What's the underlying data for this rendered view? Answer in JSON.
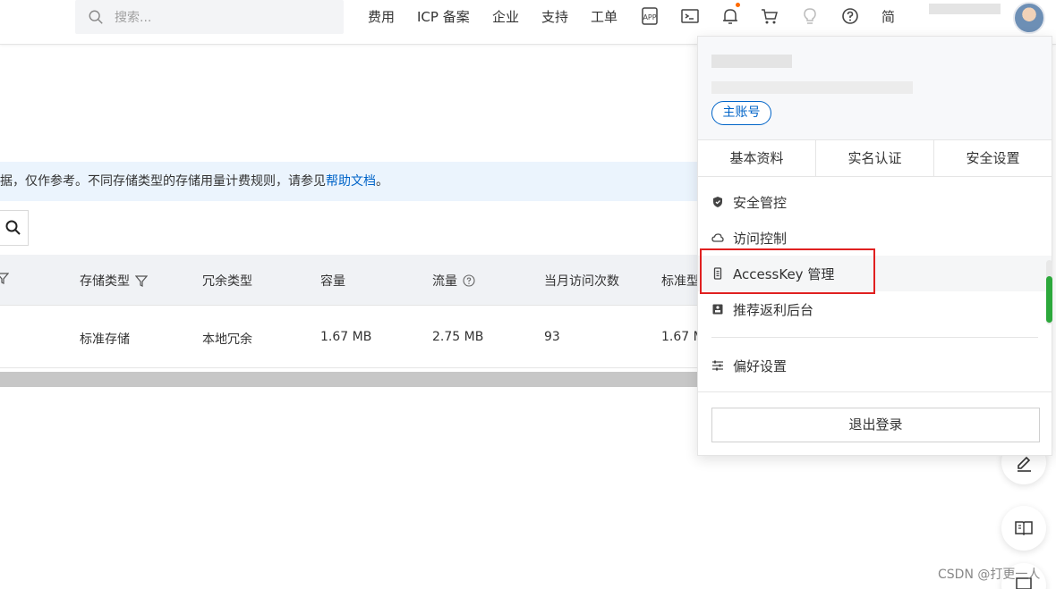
{
  "topbar": {
    "search_placeholder": "搜索...",
    "nav": [
      "费用",
      "ICP 备案",
      "企业",
      "支持",
      "工单"
    ],
    "partial_label": "简"
  },
  "page": {
    "notice_text": "据，仅作参考。不同存储类型的存储用量计费规则，请参见",
    "notice_link": "帮助文档",
    "notice_tail": "。",
    "table": {
      "headers": [
        "存储类型",
        "冗余类型",
        "容量",
        "流量",
        "当月访问次数",
        "标准型"
      ],
      "row": [
        "标准存储",
        "本地冗余",
        "1.67 MB",
        "2.75 MB",
        "93",
        "1.67 M"
      ]
    }
  },
  "dropdown": {
    "account_badge": "主账号",
    "tabs": [
      "基本资料",
      "实名认证",
      "安全设置"
    ],
    "items": [
      {
        "label": "安全管控",
        "icon": "shield-icon"
      },
      {
        "label": "访问控制",
        "icon": "cloud-icon"
      },
      {
        "label": "AccessKey 管理",
        "icon": "key-icon"
      },
      {
        "label": "推荐返利后台",
        "icon": "rebate-icon"
      }
    ],
    "preferences": "偏好设置",
    "logout": "退出登录"
  },
  "watermark": "CSDN @打更一人",
  "colors": {
    "accent": "#0064c8",
    "highlight": "#e02020",
    "notify_dot": "#ff6a00",
    "notice_bg": "#ebf4fd"
  }
}
